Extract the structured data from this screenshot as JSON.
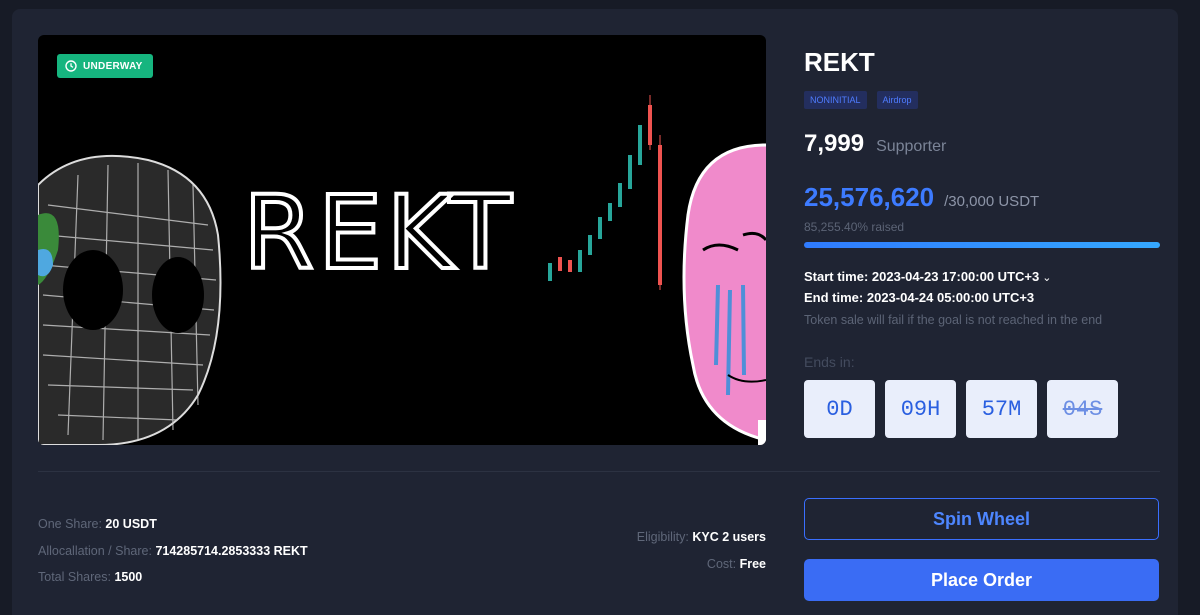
{
  "banner": {
    "badge": "UNDERWAY",
    "logo_text": "REKT"
  },
  "project": {
    "title": "REKT",
    "tags": [
      "NONINITIAL",
      "Airdrop"
    ]
  },
  "stats": {
    "supporters_count": "7,999",
    "supporters_label": "Supporter",
    "raised_amount": "25,576,620",
    "goal": "/30,000 USDT",
    "raised_pct_text": "85,255.40% raised",
    "progress_fraction": 1.0
  },
  "schedule": {
    "start_label": "Start time:",
    "start_value": "2023-04-23 17:00:00 UTC+3",
    "end_label": "End time:",
    "end_value": "2023-04-24 05:00:00 UTC+3",
    "warning": "Token sale will fail if the goal is not reached in the end"
  },
  "countdown": {
    "label": "Ends in:",
    "days": "0D",
    "hours": "09H",
    "minutes": "57M",
    "seconds": "04S"
  },
  "details": {
    "one_share_label": "One Share:",
    "one_share_value": "20 USDT",
    "alloc_label": "Allocallation / Share:",
    "alloc_value": "714285714.2853333 REKT",
    "total_label": "Total Shares:",
    "total_value": "1500",
    "elig_label": "Eligibility:",
    "elig_value": "KYC 2 users",
    "cost_label": "Cost:",
    "cost_value": "Free"
  },
  "actions": {
    "spin_label": "Spin Wheel",
    "order_label": "Place Order"
  },
  "colors": {
    "accent": "#3a6cf4",
    "badge": "#16b57f",
    "background": "#1f2433"
  }
}
